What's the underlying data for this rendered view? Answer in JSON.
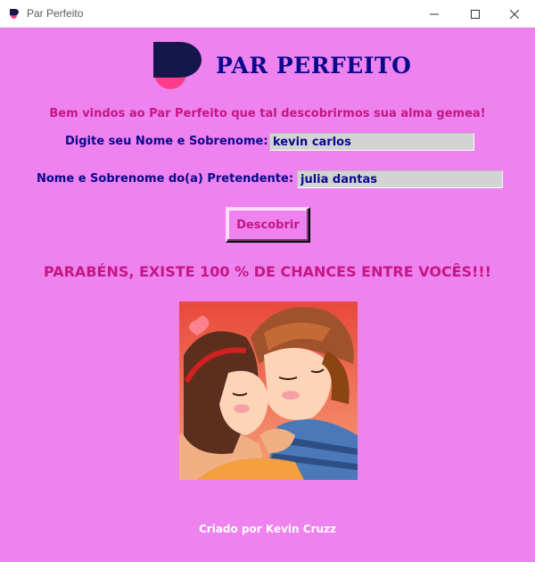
{
  "window": {
    "title": "Par Perfeito"
  },
  "header": {
    "app_title": "PAR PERFEITO",
    "logo_icon": "pinkish-P-logo-icon"
  },
  "welcome_text": "Bem vindos ao Par Perfeito que tal descobrirmos sua alma gemea!",
  "form": {
    "name_label": "Digite seu Nome e Sobrenome:",
    "name_value": "kevin carlos",
    "partner_label": "Nome e Sobrenome do(a) Pretendente:",
    "partner_value": "julia dantas",
    "submit_label": "Descobrir"
  },
  "result_text": "PARABÉNS, EXISTE 100 % DE CHANCES ENTRE VOCÊS!!!",
  "footer_text": "Criado por Kevin Cruzz",
  "colors": {
    "background": "#ee82ee",
    "title": "#0a0a8c",
    "accent": "#c71585",
    "logo_dark": "#14174a",
    "logo_pink": "#ff3d8b"
  }
}
